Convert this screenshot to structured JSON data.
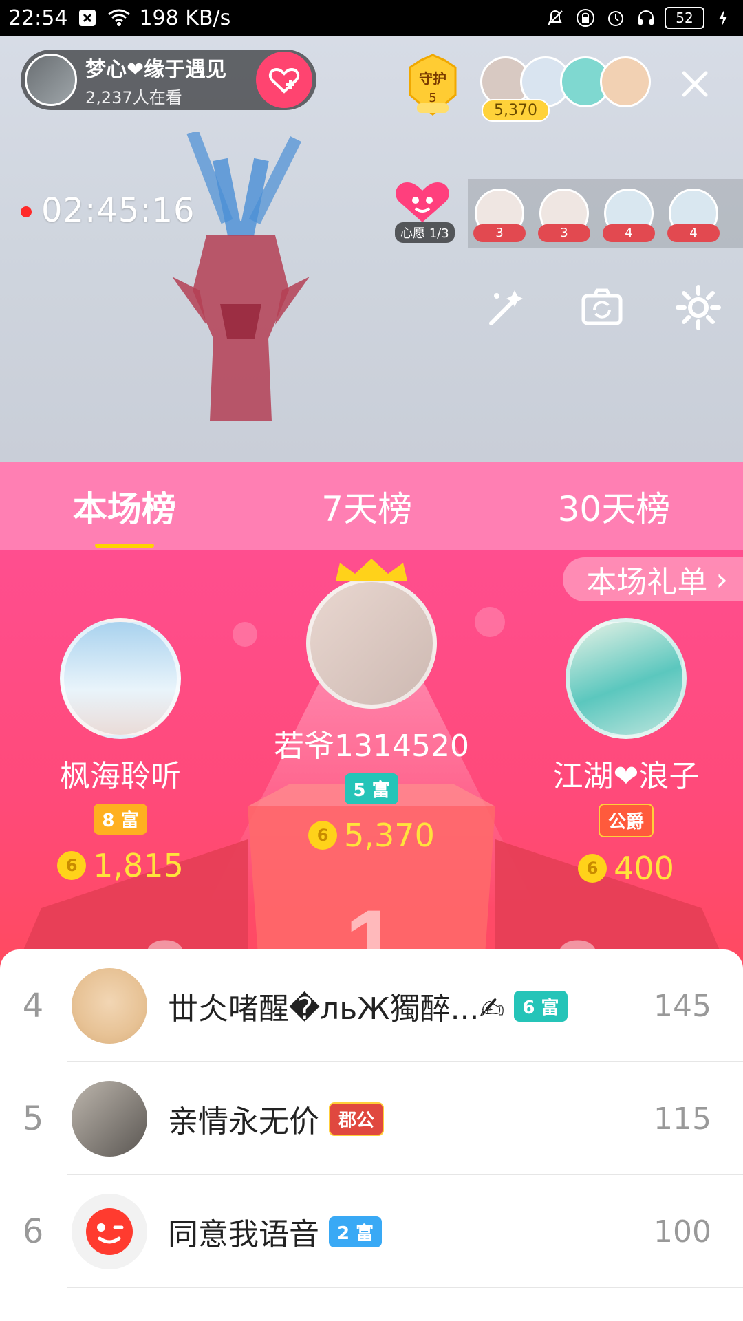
{
  "status_bar": {
    "time": "22:54",
    "net_speed": "198 KB/s",
    "battery": "52"
  },
  "live": {
    "room_name": "梦心❤缘于遇见",
    "viewers": "2,237人在看",
    "guard_label": "守护",
    "guard_count": "5",
    "fans_score": "5,370",
    "record_time": "02:45:16",
    "wish_label": "心愿 1/3",
    "audience_levels": [
      "3",
      "3",
      "4",
      "4"
    ]
  },
  "tabs": [
    {
      "label": "本场榜"
    },
    {
      "label": "7天榜"
    },
    {
      "label": "30天榜"
    }
  ],
  "gift_list_label": "本场礼单",
  "top3": {
    "first": {
      "name": "若爷1314520",
      "badge": "5 富",
      "coins": "5,370"
    },
    "second": {
      "name": "枫海聆听",
      "badge": "8 富",
      "coins": "1,815"
    },
    "third": {
      "name": "江湖❤浪子",
      "badge": "公爵",
      "coins": "400"
    }
  },
  "list": [
    {
      "rank": "4",
      "name": "丗仌啫醒�льЖ獨醉...✍",
      "badge": "6 富",
      "score": "145"
    },
    {
      "rank": "5",
      "name": "亲情永无价",
      "badge": "郡公",
      "score": "115"
    },
    {
      "rank": "6",
      "name": "同意我语音",
      "badge": "2 富",
      "score": "100"
    }
  ],
  "podium_numbers": [
    "1",
    "2",
    "3"
  ],
  "coin_icon_text": "6"
}
